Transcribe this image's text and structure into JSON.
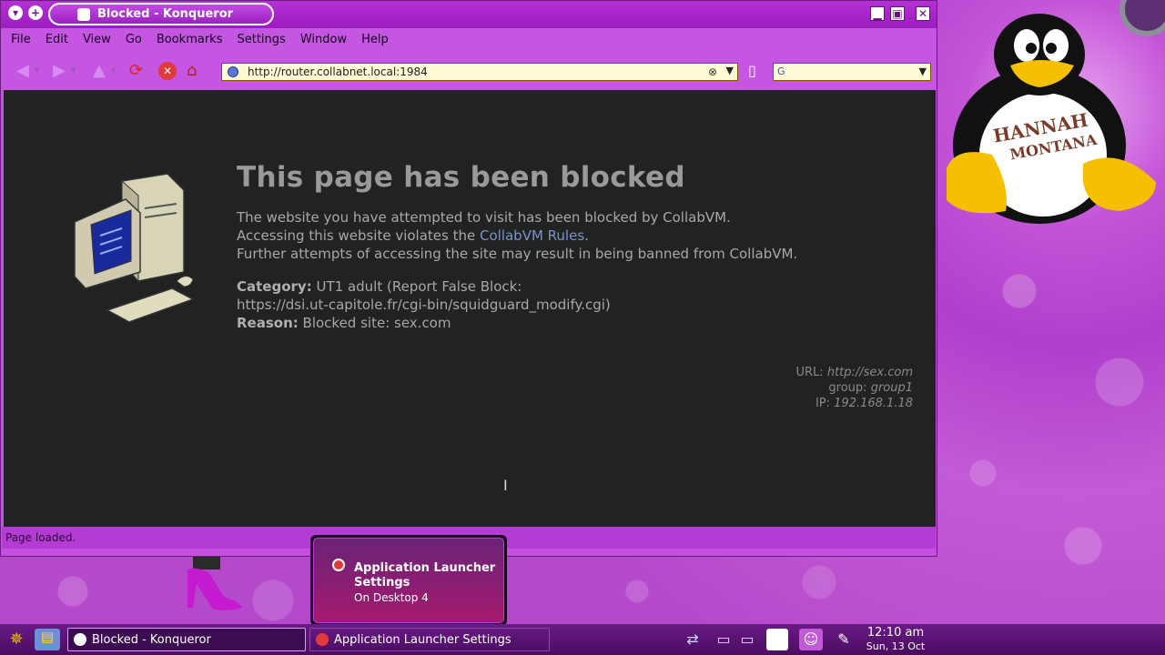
{
  "window": {
    "title": "Blocked - Konqueror"
  },
  "menu": [
    "File",
    "Edit",
    "View",
    "Go",
    "Bookmarks",
    "Settings",
    "Window",
    "Help"
  ],
  "toolbar": {
    "url": "http://router.collabnet.local:1984",
    "search_placeholder": ""
  },
  "page": {
    "heading": "This page has been blocked",
    "line1": "The website you have attempted to visit has been blocked by CollabVM.",
    "line2_prefix": "Accessing this website violates the ",
    "line2_link": "CollabVM Rules",
    "line2_suffix": ".",
    "line3": "Further attempts of accessing the site may result in being banned from CollabVM.",
    "category_label": "Category:",
    "category_value": "UT1 adult (Report False Block:",
    "category_link": "https://dsi.ut-capitole.fr/cgi-bin/squidguard_modify.cgi)",
    "reason_label": "Reason:",
    "reason_value": "Blocked site: sex.com",
    "meta_url_label": "URL:",
    "meta_url": "http://sex.com",
    "meta_group_label": "group:",
    "meta_group": "group1",
    "meta_ip_label": "IP:",
    "meta_ip": "192.168.1.18"
  },
  "status": "Page loaded.",
  "notification": {
    "title": "Application Launcher Settings",
    "subtitle": "On Desktop 4"
  },
  "taskbar": {
    "tasks": [
      "Blocked - Konqueror",
      "Application Launcher Settings"
    ],
    "time": "12:10 am",
    "date": "Sun, 13 Oct"
  },
  "colors": {
    "accent": "#c456e2",
    "content_bg": "#222222",
    "link": "#7c93c6"
  }
}
